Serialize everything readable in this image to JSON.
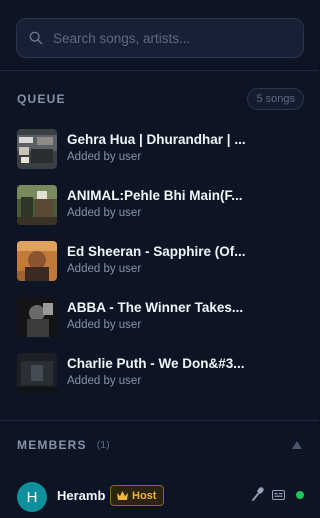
{
  "search": {
    "placeholder": "Search songs, artists..."
  },
  "queue": {
    "heading": "QUEUE",
    "count_label": "5 songs",
    "items": [
      {
        "title": "Gehra Hua | Dhurandhar | ...",
        "subtitle": "Added by user"
      },
      {
        "title": "ANIMAL:Pehle Bhi Main(F...",
        "subtitle": "Added by user"
      },
      {
        "title": "Ed Sheeran - Sapphire (Of...",
        "subtitle": "Added by user"
      },
      {
        "title": "ABBA - The Winner Takes...",
        "subtitle": "Added by user"
      },
      {
        "title": "Charlie Puth - We Don&#3...",
        "subtitle": "Added by user"
      }
    ]
  },
  "members": {
    "heading": "MEMBERS",
    "count": "(1)",
    "list": [
      {
        "initial": "H",
        "name": "Heramb",
        "badge": "Host",
        "status": "online"
      }
    ]
  },
  "colors": {
    "background": "#0d1424",
    "accent_teal": "#0e8f9c",
    "host_gold": "#f0b43c",
    "online_green": "#22c55e"
  },
  "icons": [
    "search-icon",
    "collapse-arrow-icon",
    "crown-icon",
    "mic-icon",
    "cc-icon"
  ]
}
